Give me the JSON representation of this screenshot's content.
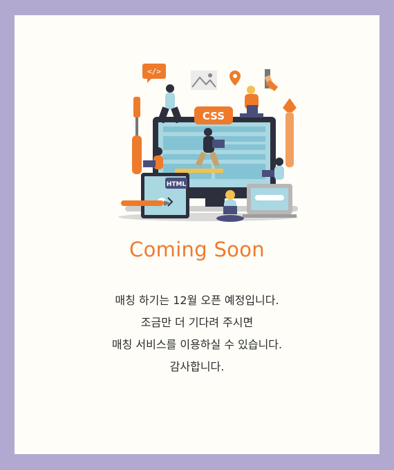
{
  "title": "Coming Soon",
  "message_lines": [
    "매칭 하기는 12월 오픈 예정입니다.",
    "조금만 더 기다려 주시면",
    "매칭 서비스를 이용하실 수 있습니다.",
    "감사합니다."
  ],
  "illustration": {
    "code_badge": "</>",
    "css_badge": "CSS",
    "html_badge": "HTML",
    "icons": [
      "code-icon",
      "image-icon",
      "location-pin-icon",
      "color-swatch-icon",
      "pen-nib-icon",
      "screwdriver-icon",
      "pencil-icon"
    ]
  },
  "colors": {
    "background": "#b2a9d0",
    "panel": "#fefdf7",
    "accent": "#ee7b2c",
    "screen": "#a9d7e2",
    "device_frame": "#2d2f3d"
  }
}
